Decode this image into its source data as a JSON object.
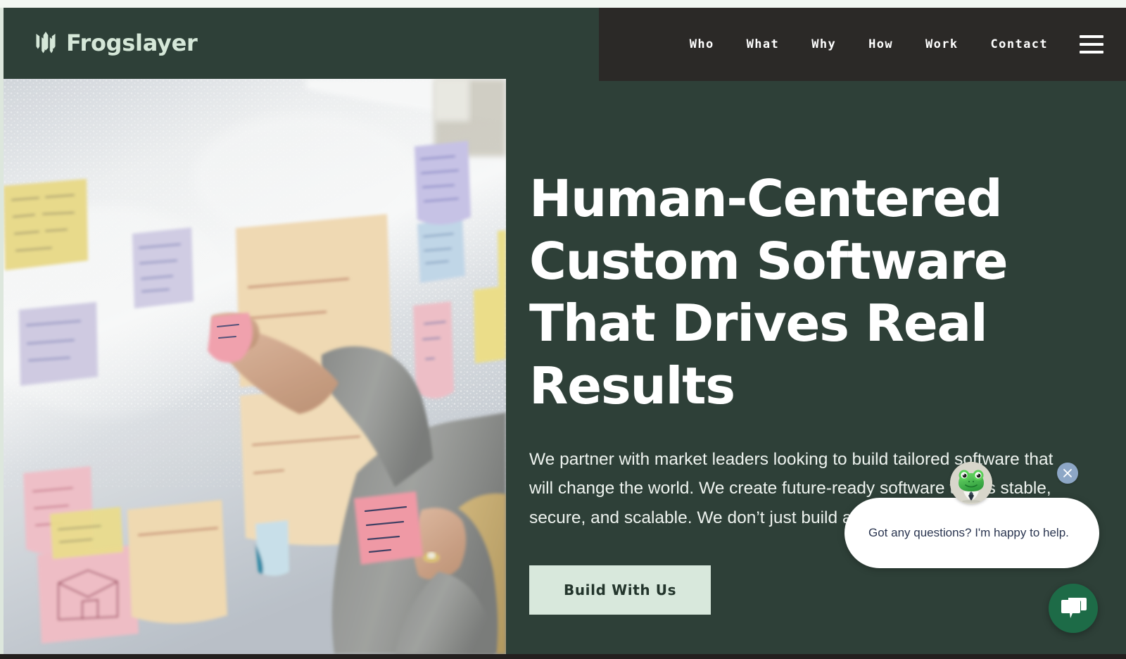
{
  "brand": {
    "name": "Frogslayer",
    "logo_icon": "frogslayer-trident-mark",
    "logo_color": "#d5e7d8",
    "header_bg": "#2e4038"
  },
  "nav": {
    "bg": "#2b2927",
    "items": [
      {
        "label": "Who"
      },
      {
        "label": "What"
      },
      {
        "label": "Why"
      },
      {
        "label": "How"
      },
      {
        "label": "Work"
      },
      {
        "label": "Contact"
      }
    ],
    "menu_icon": "hamburger-menu-icon"
  },
  "hero": {
    "headline": "Human-Centered Custom Software That Drives Real Results",
    "subcopy": "We partner with market leaders looking to build tailored software that will change the world. We create future-ready software that is stable, secure, and scalable. We don’t just build apps, we build businesses.",
    "cta_label": "Build With Us",
    "cta_bg": "#d8e8dc",
    "cta_text_color": "#23352c",
    "image_alt": "Person placing a pink sticky note on a whiteboard covered with colorful sticky notes"
  },
  "chat": {
    "avatar_icon": "frog-avatar-icon",
    "message": "Got any questions? I'm happy to help.",
    "message_color": "#2a3550",
    "close_icon": "close-icon",
    "close_bg": "#8da7c6",
    "launcher_icon": "chat-bubbles-icon",
    "launcher_bg": "#1d6b47"
  }
}
